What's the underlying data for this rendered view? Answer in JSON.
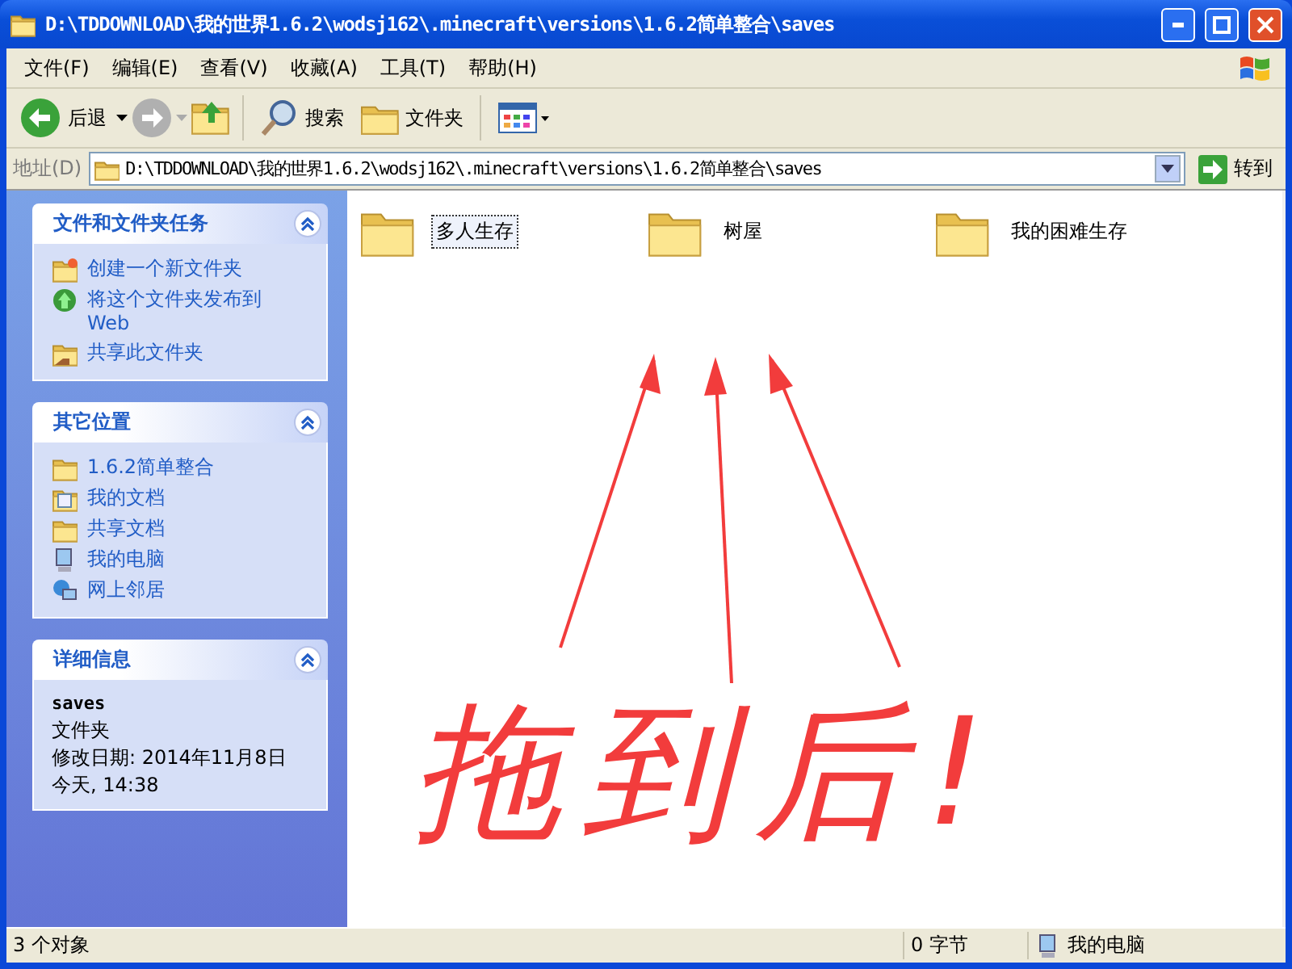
{
  "window": {
    "title": "D:\\TDDOWNLOAD\\我的世界1.6.2\\wodsj162\\.minecraft\\versions\\1.6.2简单整合\\saves"
  },
  "menu": [
    "文件(F)",
    "编辑(E)",
    "查看(V)",
    "收藏(A)",
    "工具(T)",
    "帮助(H)"
  ],
  "toolbar": {
    "back": "后退",
    "search": "搜索",
    "folders": "文件夹"
  },
  "address": {
    "label": "地址(D)",
    "value": "D:\\TDDOWNLOAD\\我的世界1.6.2\\wodsj162\\.minecraft\\versions\\1.6.2简单整合\\saves",
    "go": "转到"
  },
  "sidebar": {
    "panels": [
      {
        "title": "文件和文件夹任务",
        "expanded": true,
        "items": [
          {
            "label": "创建一个新文件夹",
            "kind": "new-folder"
          },
          {
            "label": "将这个文件夹发布到 Web",
            "kind": "publish"
          },
          {
            "label": "共享此文件夹",
            "kind": "share"
          }
        ]
      },
      {
        "title": "其它位置",
        "expanded": true,
        "items": [
          {
            "label": "1.6.2简单整合",
            "kind": "folder"
          },
          {
            "label": "我的文档",
            "kind": "documents"
          },
          {
            "label": "共享文档",
            "kind": "folder"
          },
          {
            "label": "我的电脑",
            "kind": "computer"
          },
          {
            "label": "网上邻居",
            "kind": "network"
          }
        ]
      },
      {
        "title": "详细信息",
        "expanded": true,
        "details": {
          "name": "saves",
          "type": "文件夹",
          "modified": "修改日期: 2014年11月8日",
          "time": "今天, 14:38"
        }
      }
    ]
  },
  "files": [
    {
      "name": "多人生存",
      "selected": true
    },
    {
      "name": "树屋",
      "selected": false
    },
    {
      "name": "我的困难生存",
      "selected": false
    }
  ],
  "annotation": {
    "text": "拖到后!"
  },
  "status_bar": {
    "objects": "3 个对象",
    "size": "0 字节",
    "location": "我的电脑"
  }
}
